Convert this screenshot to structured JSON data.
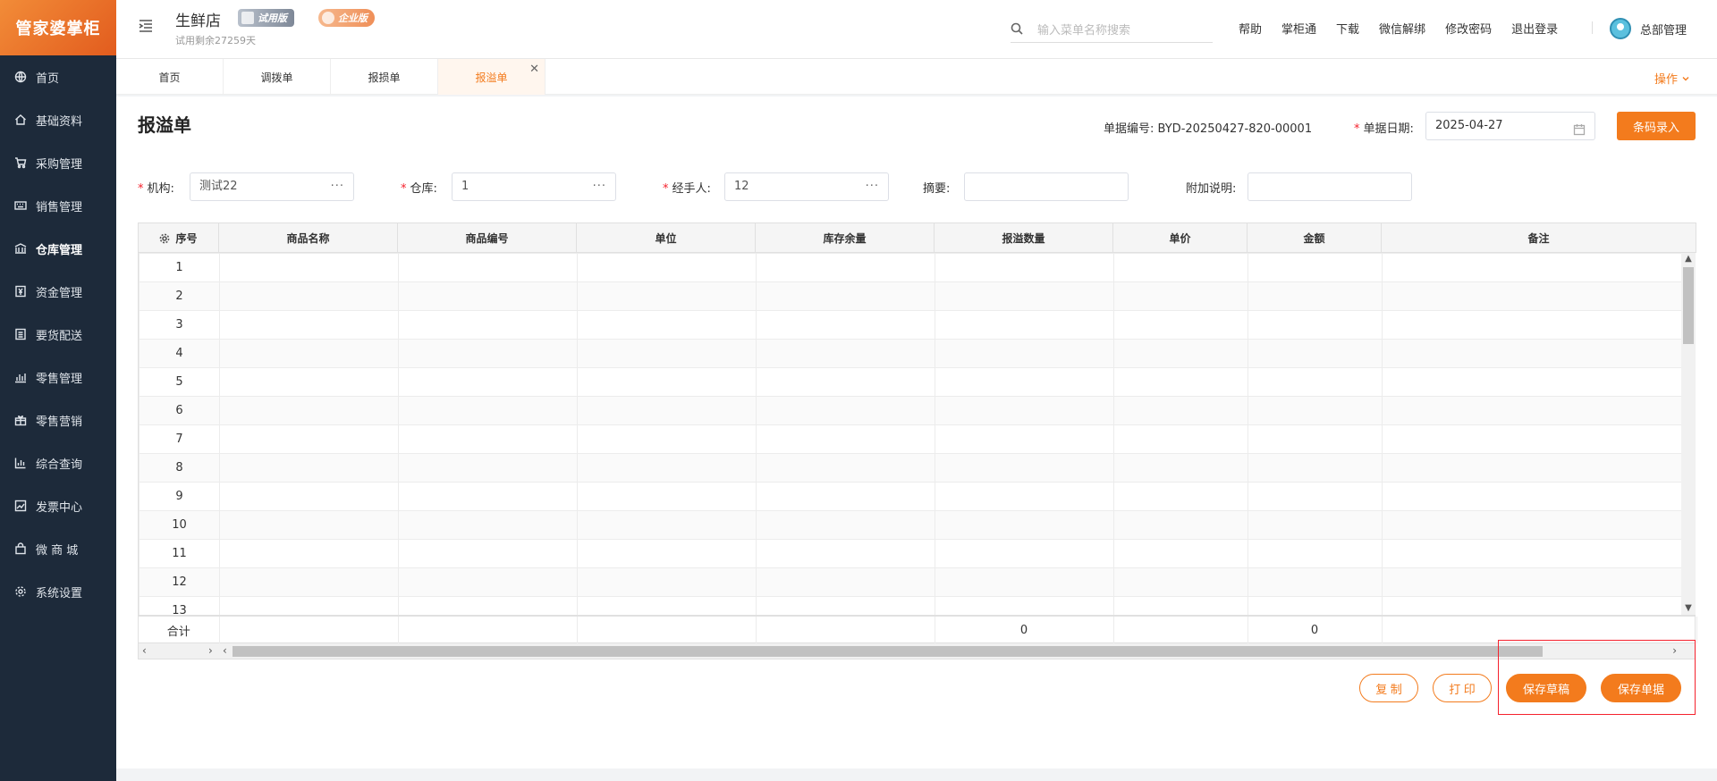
{
  "app": {
    "logo_text": "管家婆掌柜",
    "store_name": "生鲜店",
    "trial_badge": "试用版",
    "edition_badge": "企业版",
    "trial_remaining": "试用剩余27259天"
  },
  "sidebar": {
    "items": [
      {
        "label": "首页",
        "icon": "globe-icon"
      },
      {
        "label": "基础资料",
        "icon": "home-icon"
      },
      {
        "label": "采购管理",
        "icon": "cart-icon"
      },
      {
        "label": "销售管理",
        "icon": "keyboard-icon"
      },
      {
        "label": "仓库管理",
        "icon": "bank-icon"
      },
      {
        "label": "资金管理",
        "icon": "yen-icon"
      },
      {
        "label": "要货配送",
        "icon": "list-icon"
      },
      {
        "label": "零售管理",
        "icon": "chart-icon"
      },
      {
        "label": "零售营销",
        "icon": "gift-icon"
      },
      {
        "label": "综合查询",
        "icon": "bar-chart-icon"
      },
      {
        "label": "发票中心",
        "icon": "trend-icon"
      },
      {
        "label": "微 商 城",
        "icon": "bag-icon"
      },
      {
        "label": "系统设置",
        "icon": "gear-icon"
      }
    ],
    "active_index": 4
  },
  "header": {
    "search_placeholder": "输入菜单名称搜索",
    "links": [
      "帮助",
      "掌柜通",
      "下载",
      "微信解绑",
      "修改密码",
      "退出登录"
    ],
    "user": "总部管理"
  },
  "tabs": {
    "items": [
      "首页",
      "调拨单",
      "报损单",
      "报溢单"
    ],
    "active_index": 3,
    "ops_label": "操作"
  },
  "form": {
    "title": "报溢单",
    "doc_no_label": "单据编号:",
    "doc_no": "BYD-20250427-820-00001",
    "doc_date_label": "单据日期:",
    "doc_date": "2025-04-27",
    "barcode_button": "条码录入",
    "org_label": "机构:",
    "org_value": "测试22",
    "warehouse_label": "仓库:",
    "warehouse_value": "1",
    "handler_label": "经手人:",
    "handler_value": "12",
    "summary_label": "摘要:",
    "summary_value": "",
    "extra_label": "附加说明:",
    "extra_value": ""
  },
  "table": {
    "columns": [
      "序号",
      "商品名称",
      "商品编号",
      "单位",
      "库存余量",
      "报溢数量",
      "单价",
      "金额",
      "备注"
    ],
    "row_numbers": [
      "1",
      "2",
      "3",
      "4",
      "5",
      "6",
      "7",
      "8",
      "9",
      "10",
      "11",
      "12",
      "13"
    ],
    "total_label": "合计",
    "total_qty": "0",
    "total_amount": "0"
  },
  "actions": {
    "copy": "复 制",
    "print": "打 印",
    "save_draft": "保存草稿",
    "save_doc": "保存单据"
  },
  "colors": {
    "accent": "#f37b1d",
    "sidebar_bg": "#1d2a3a",
    "highlight_border": "#f5222d"
  }
}
